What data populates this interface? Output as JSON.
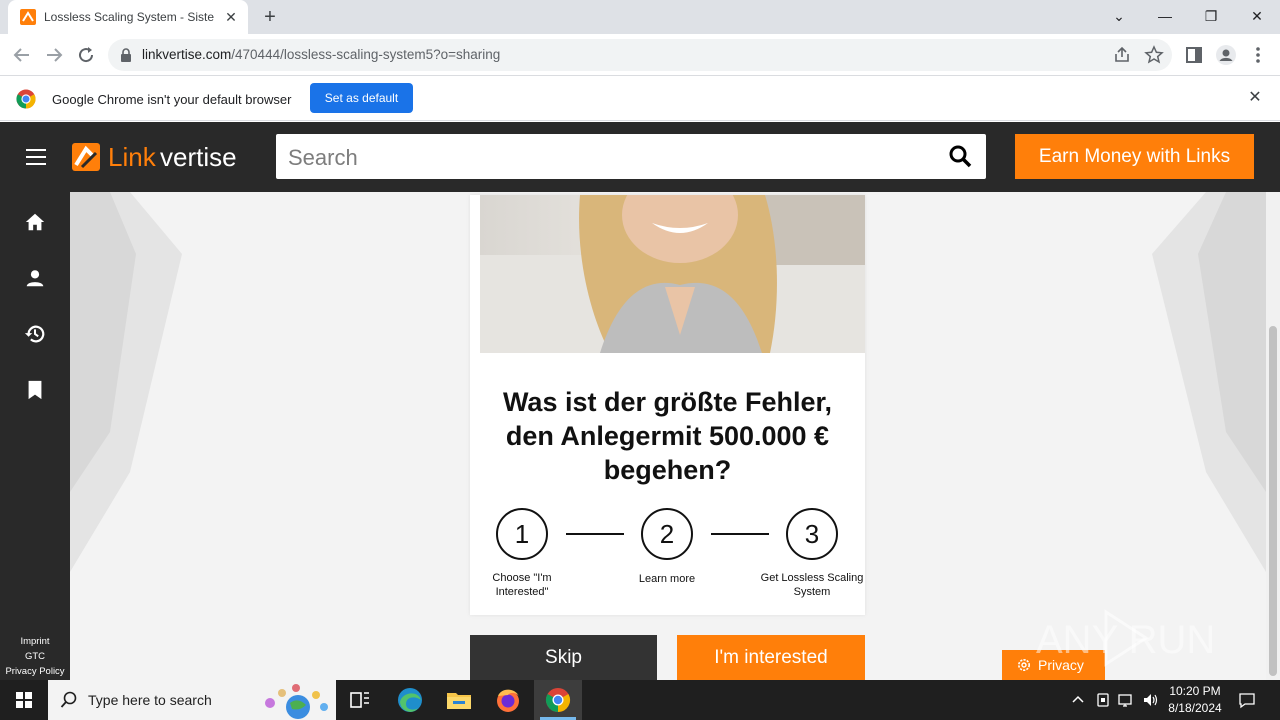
{
  "browser": {
    "tab_title": "Lossless Scaling System - Sistem",
    "tab_close": "✕",
    "new_tab": "+",
    "url_host": "linkvertise.com",
    "url_path": "/470444/lossless-scaling-system5?o=sharing",
    "window_buttons": {
      "tabsearch": "⌄",
      "minimize": "—",
      "restore": "❐",
      "close": "✕"
    }
  },
  "infobar": {
    "message": "Google Chrome isn't your default browser",
    "button": "Set as default",
    "close": "✕"
  },
  "header": {
    "logo_part1": "Link",
    "logo_part2": "vertise",
    "search_placeholder": "Search",
    "earn_button": "Earn Money with Links"
  },
  "sidebar": {
    "icons": [
      "home-icon",
      "user-icon",
      "history-icon",
      "bookmark-icon"
    ],
    "footer": [
      "Imprint",
      "GTC",
      "Privacy Policy"
    ]
  },
  "ad": {
    "headline": "Was ist der größte Fehler, den Anlegermit 500.000 € begehen?",
    "steps": [
      {
        "number": "1",
        "label": "Choose \"I'm Interested\""
      },
      {
        "number": "2",
        "label": "Learn more"
      },
      {
        "number": "3",
        "label": "Get Lossless Scaling System"
      }
    ],
    "skip_button": "Skip",
    "interested_button": "I'm interested",
    "privacy_button": "Privacy"
  },
  "watermark": "ANY RUN",
  "taskbar": {
    "search_placeholder": "Type here to search",
    "time": "10:20 PM",
    "date": "8/18/2024"
  },
  "colors": {
    "brand_orange": "#ff7f0a",
    "header_dark": "#292929",
    "chrome_blue": "#1a73e8"
  }
}
